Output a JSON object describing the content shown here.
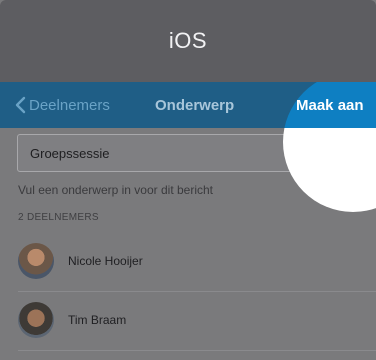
{
  "banner": {
    "title": "iOS"
  },
  "nav": {
    "back_label": "Deelnemers",
    "title": "Onderwerp",
    "action_label": "Maak aan"
  },
  "subject": {
    "value": "Groepssessie",
    "hint": "Vul een onderwerp in voor dit bericht"
  },
  "participants": {
    "header": "2 DEELNEMERS",
    "items": [
      {
        "name": "Nicole Hooijer"
      },
      {
        "name": "Tim Braam"
      }
    ]
  },
  "colors": {
    "navbar": "#1f5e86",
    "accent": "#0e7fc2",
    "overlay": "#7a7a7c"
  }
}
